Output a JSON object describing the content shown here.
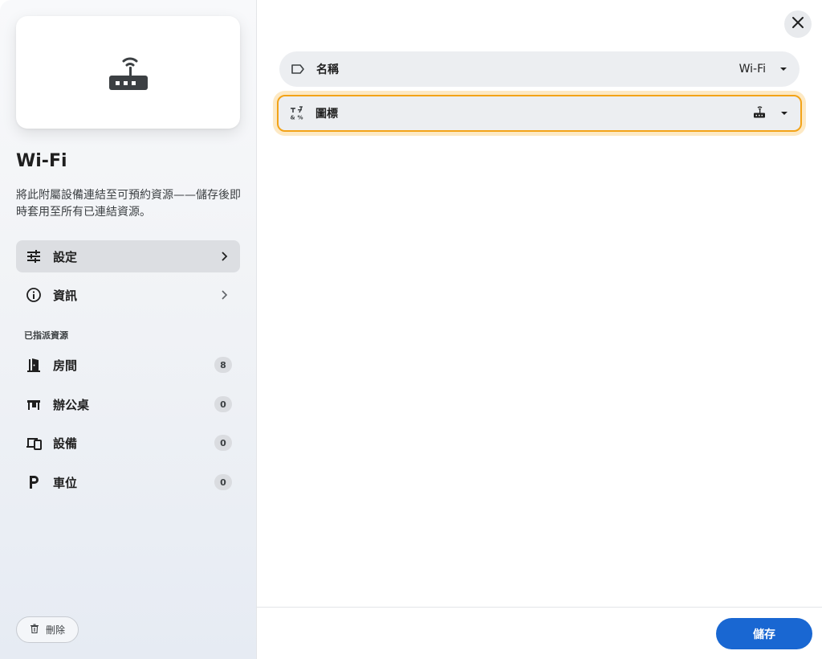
{
  "resource": {
    "title": "Wi-Fi",
    "description": "將此附屬設備連結至可預約資源——儲存後即時套用至所有已連結資源。",
    "preview_icon": "router-icon"
  },
  "sidebar": {
    "nav": [
      {
        "label": "設定",
        "icon": "tune-icon",
        "active": true
      },
      {
        "label": "資訊",
        "icon": "info-icon",
        "active": false
      }
    ],
    "section_label": "已指派資源",
    "resources": [
      {
        "label": "房間",
        "icon": "door-icon",
        "count": "8"
      },
      {
        "label": "辦公桌",
        "icon": "desk-icon",
        "count": "0"
      },
      {
        "label": "設備",
        "icon": "devices-icon",
        "count": "0"
      },
      {
        "label": "車位",
        "icon": "parking-icon",
        "count": "0"
      }
    ],
    "delete_label": "刪除"
  },
  "main": {
    "fields": [
      {
        "label": "名稱",
        "value": "Wi-Fi",
        "icon": "label-icon"
      },
      {
        "label": "圖標",
        "value_icon": "router-icon",
        "icon": "symbols-icon"
      }
    ],
    "save_label": "儲存"
  },
  "colors": {
    "accent": "#1967d2",
    "focus_ring": "#f3a317",
    "active_nav_bg": "#dcdee2"
  }
}
